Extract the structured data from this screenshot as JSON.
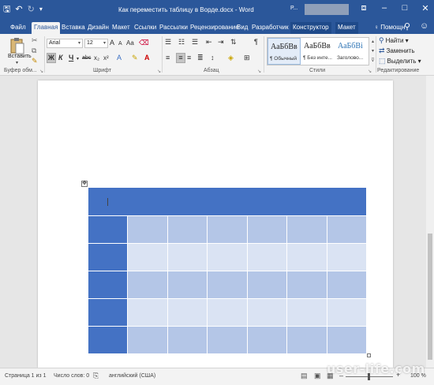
{
  "titlebar": {
    "title": "Как переместить таблицу в Ворде.docx - Word",
    "account_initial": "Р...",
    "qat": {
      "save_icon": "save-icon",
      "undo_icon": "undo-icon",
      "redo_icon": "redo-icon",
      "customize_icon": "customize-qat-icon"
    },
    "window_buttons": {
      "ribbon_options": "ribbon-display-options-icon",
      "minimize": "minimize-icon",
      "maximize": "maximize-icon",
      "close": "close-icon"
    }
  },
  "tabs": {
    "file": "Файл",
    "home": "Главная",
    "insert": "Вставка",
    "design": "Дизайн",
    "layout": "Макет",
    "references": "Ссылки",
    "mailings": "Рассылки",
    "review": "Рецензирование",
    "view": "Вид",
    "developer": "Разработчик",
    "table_design": "Конструктор",
    "table_layout": "Макет",
    "tell_me": "Помощн"
  },
  "ribbon": {
    "clipboard": {
      "paste": "Вставить",
      "label": "Буфер обм..."
    },
    "font": {
      "font_name": "Arial",
      "font_size": "12",
      "label": "Шрифт",
      "bold": "Ж",
      "italic": "К",
      "underline": "Ч",
      "strike": "abc",
      "subscript": "x₂",
      "superscript": "x²",
      "grow": "A",
      "shrink": "A",
      "change_case": "Aa"
    },
    "paragraph": {
      "label": "Абзац",
      "pilcrow": "¶"
    },
    "styles": {
      "label": "Стили",
      "items": [
        {
          "sample": "АаБбВв",
          "name": "¶ Обычный"
        },
        {
          "sample": "АаБбВв",
          "name": "¶ Без инте..."
        },
        {
          "sample": "АаБбВі",
          "name": "Заголово..."
        }
      ]
    },
    "editing": {
      "label": "Редактирование",
      "find": "Найти",
      "replace": "Заменить",
      "select": "Выделить"
    }
  },
  "table": {
    "rows": 6,
    "columns": 7
  },
  "statusbar": {
    "page": "Страница 1 из 1",
    "words": "Число слов: 0",
    "language": "английский (США)",
    "zoom": "100 %",
    "zoom_value": 100
  },
  "watermark": "user-life.com",
  "colors": {
    "accent": "#2b579a",
    "table_header": "#4472c4",
    "band_dark": "#b4c6e7",
    "band_light": "#dae3f3"
  }
}
